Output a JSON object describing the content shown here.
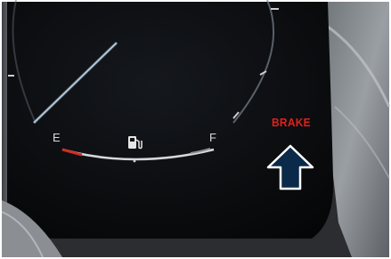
{
  "fuel_gauge": {
    "empty_label": "E",
    "full_label": "F",
    "icon": "fuel-pump-icon"
  },
  "warning": {
    "label": "BRAKE",
    "color": "#e0201c"
  },
  "callout": {
    "icon": "arrow-up-icon",
    "color": "#0b2a4a"
  }
}
